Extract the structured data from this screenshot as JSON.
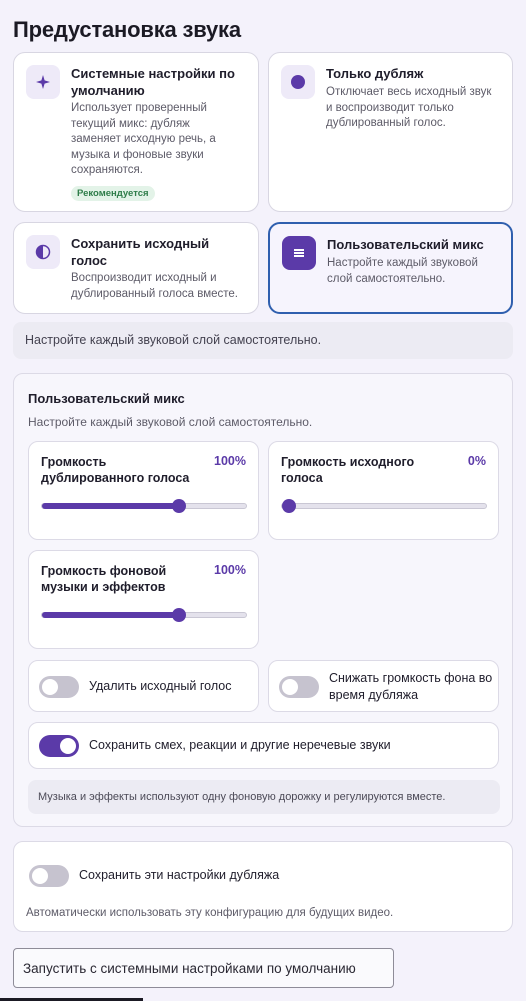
{
  "page": {
    "title": "Предустановка звука"
  },
  "presets": [
    {
      "title": "Системные настройки по умолчанию",
      "desc": "Использует проверенный текущий микс: дубляж заменяет исходную речь, а музыка и фоновые звуки сохраняются.",
      "badge": "Рекомендуется",
      "icon": "sparkle-icon"
    },
    {
      "title": "Только дубляж",
      "desc": "Отключает весь исходный звук и воспроизводит только дублированный голос.",
      "icon": "circle-icon"
    },
    {
      "title": "Сохранить исходный голос",
      "desc": "Воспроизводит исходный и дублированный голоса вместе.",
      "icon": "half-circle-icon"
    },
    {
      "title": "Пользовательский микс",
      "desc": "Настройте каждый звуковой слой самостоятельно.",
      "icon": "sliders-icon",
      "selected": true
    }
  ],
  "info_bar": "Настройте каждый звуковой слой самостоятельно.",
  "custom_mix": {
    "title": "Пользовательский микс",
    "subtitle": "Настройте каждый звуковой слой самостоятельно.",
    "sliders": [
      {
        "label": "Громкость дублированного голоса",
        "value_text": "100%",
        "fraction": 0.67
      },
      {
        "label": "Громкость исходного голоса",
        "value_text": "0%",
        "fraction": 0.0
      },
      {
        "label": "Громкость фоновой музыки и эффектов",
        "value_text": "100%",
        "fraction": 0.67
      }
    ],
    "toggles": [
      {
        "label": "Удалить исходный голос",
        "on": false
      },
      {
        "label": "Снижать громкость фона во время дубляжа",
        "on": false
      },
      {
        "label": "Сохранить смех, реакции и другие неречевые звуки",
        "on": true
      }
    ],
    "note": "Музыка и эффекты используют одну фоновую дорожку и регулируются вместе."
  },
  "save_settings": {
    "label": "Сохранить эти настройки дубляжа",
    "on": false,
    "hint": "Автоматически использовать эту конфигурацию для будущих видео."
  },
  "start_button": "Запустить с системными настройками по умолчанию",
  "colors": {
    "accent": "#5b3aa8",
    "selected_border": "#2f5fae"
  }
}
